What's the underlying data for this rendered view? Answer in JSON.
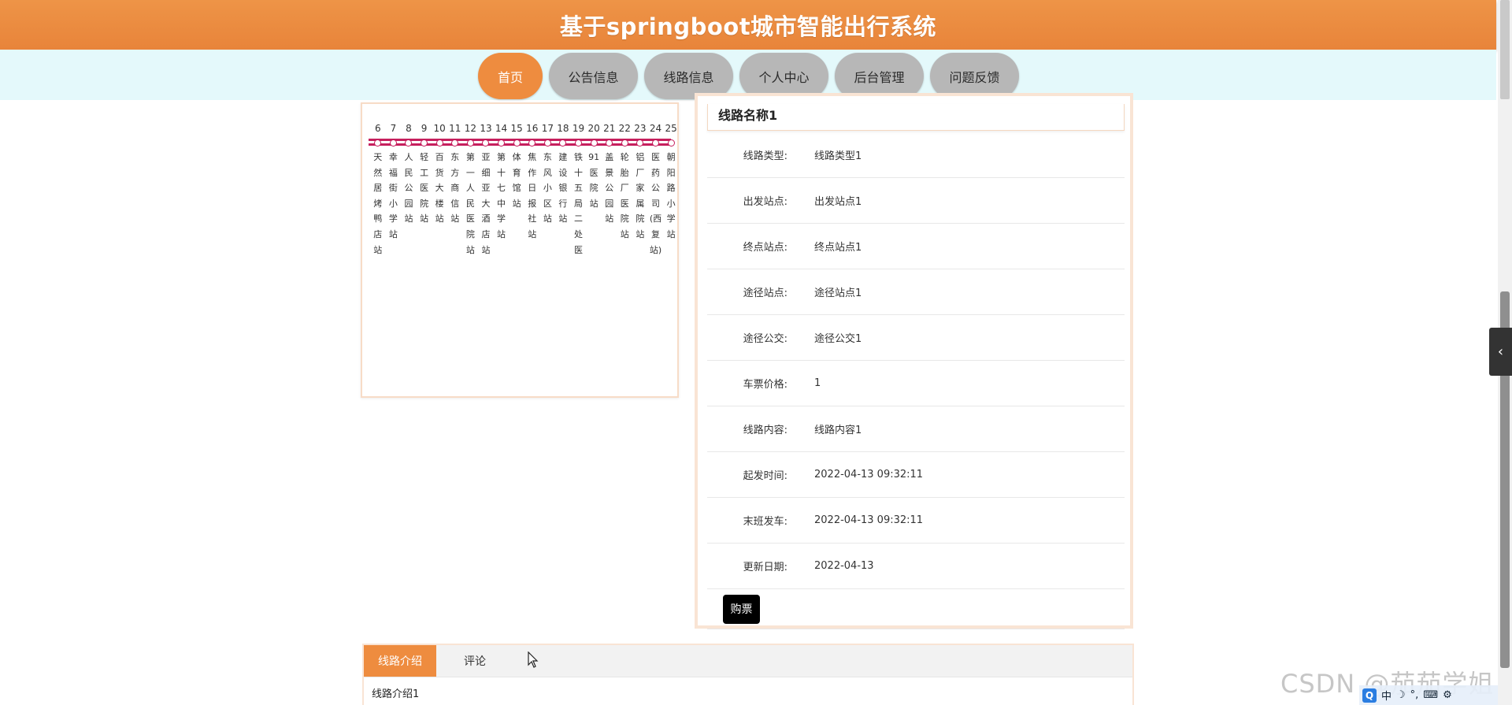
{
  "header": {
    "title": "基于springboot城市智能出行系统"
  },
  "nav": {
    "items": [
      {
        "label": "首页",
        "active": true
      },
      {
        "label": "公告信息",
        "active": false
      },
      {
        "label": "线路信息",
        "active": false
      },
      {
        "label": "个人中心",
        "active": false
      },
      {
        "label": "后台管理",
        "active": false
      },
      {
        "label": "问题反馈",
        "active": false
      }
    ]
  },
  "route_map": {
    "line_color": "#c61f5d",
    "stations": [
      {
        "num": "6",
        "name": "天然居烤鸭店站"
      },
      {
        "num": "7",
        "name": "幸福街小学站"
      },
      {
        "num": "8",
        "name": "人民公园站"
      },
      {
        "num": "9",
        "name": "轻工医院站"
      },
      {
        "num": "10",
        "name": "百货大楼站"
      },
      {
        "num": "11",
        "name": "东方商信站"
      },
      {
        "num": "12",
        "name": "第一人民医院站"
      },
      {
        "num": "13",
        "name": "亚细亚大酒店站"
      },
      {
        "num": "14",
        "name": "第十七中学站"
      },
      {
        "num": "15",
        "name": "体育馆站"
      },
      {
        "num": "16",
        "name": "焦作日报社站"
      },
      {
        "num": "17",
        "name": "东风小区站"
      },
      {
        "num": "18",
        "name": "建设银行站"
      },
      {
        "num": "19",
        "name": "铁十五局二处医"
      },
      {
        "num": "20",
        "name": "91医院站"
      },
      {
        "num": "21",
        "name": "盖景公园站"
      },
      {
        "num": "22",
        "name": "轮胎厂医院站"
      },
      {
        "num": "23",
        "name": "铝厂家属院站"
      },
      {
        "num": "24",
        "name": "医药公司(西复站)"
      },
      {
        "num": "25",
        "name": "朝阳路小学站"
      }
    ]
  },
  "details": {
    "title": "线路名称1",
    "rows": [
      {
        "label": "线路类型:",
        "value": "线路类型1"
      },
      {
        "label": "出发站点:",
        "value": "出发站点1"
      },
      {
        "label": "终点站点:",
        "value": "终点站点1"
      },
      {
        "label": "途径站点:",
        "value": "途径站点1"
      },
      {
        "label": "途径公交:",
        "value": "途径公交1"
      },
      {
        "label": "车票价格:",
        "value": "1"
      },
      {
        "label": "线路内容:",
        "value": "线路内容1"
      },
      {
        "label": "起发时间:",
        "value": "2022-04-13 09:32:11"
      },
      {
        "label": "末班发车:",
        "value": "2022-04-13 09:32:11"
      },
      {
        "label": "更新日期:",
        "value": "2022-04-13"
      }
    ],
    "buy_label": "购票"
  },
  "tabs": {
    "items": [
      {
        "label": "线路介绍",
        "active": true
      },
      {
        "label": "评论",
        "active": false
      }
    ],
    "content": "线路介绍1"
  },
  "watermark": "CSDN @茄茄学姐",
  "ime": {
    "logo": "Q",
    "lang": "中"
  },
  "accent_color": "#ee8c3f"
}
